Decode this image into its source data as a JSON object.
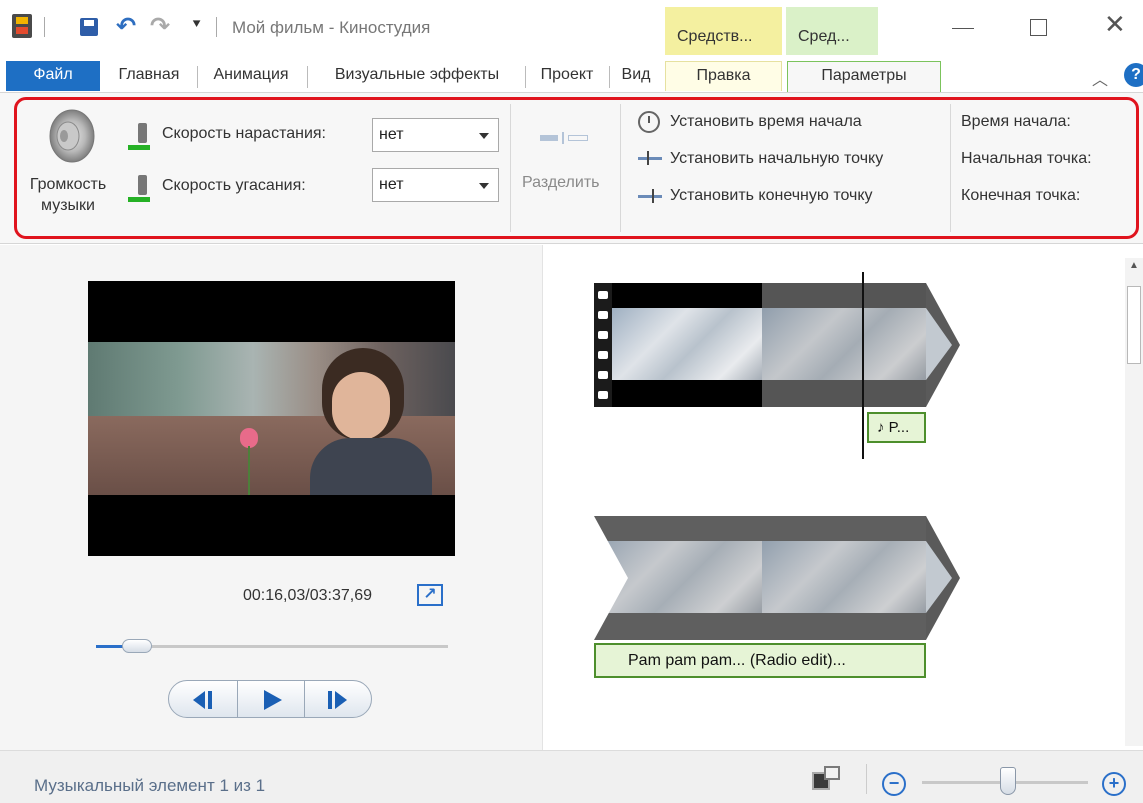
{
  "window": {
    "title": "Мой фильм - Киностудия",
    "context_tab_1": "Средств...",
    "context_tab_2": "Сред..."
  },
  "ribbon_tabs": {
    "file": "Файл",
    "home": "Главная",
    "animation": "Анимация",
    "visual_effects": "Визуальные эффекты",
    "project": "Проект",
    "view": "Вид",
    "edit": "Правка",
    "options": "Параметры"
  },
  "ribbon": {
    "music_volume_line1": "Громкость",
    "music_volume_line2": "музыки",
    "fade_in_label": "Скорость нарастания:",
    "fade_in_value": "нет",
    "fade_out_label": "Скорость угасания:",
    "fade_out_value": "нет",
    "split_label": "Разделить",
    "set_start_time": "Установить время начала",
    "set_start_point": "Установить начальную точку",
    "set_end_point": "Установить конечную точку",
    "start_time_label": "Время начала:",
    "start_point_label": "Начальная точка:",
    "end_point_label": "Конечная точка:"
  },
  "preview": {
    "timecode": "00:16,03/03:37,69",
    "seek_progress": 0.08
  },
  "storyboard": {
    "music_clip_short": "♪ P...",
    "music_clip_full": "Pam pam pam... (Radio edit)..."
  },
  "status": {
    "text": "Музыкальный элемент 1 из 1",
    "zoom_level": 0.52
  },
  "colors": {
    "file_tab": "#1e6fc4",
    "context_tab_yellow": "#f4f0a0",
    "context_tab_green": "#daf1c8",
    "highlight": "#e0141e",
    "music_clip_bg": "#e6f4d6",
    "music_clip_border": "#4d8f2c"
  }
}
